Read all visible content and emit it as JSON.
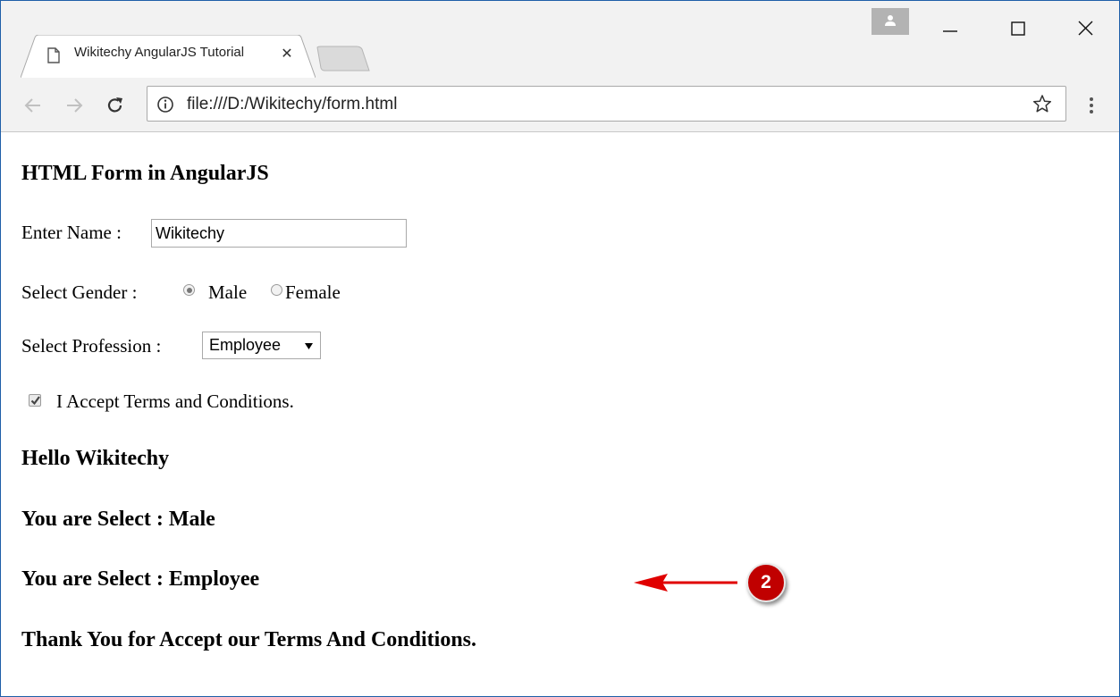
{
  "browser": {
    "tab_title": "Wikitechy AngularJS Tutorial",
    "tab_close": "✕",
    "url": "file:///D:/Wikitechy/form.html"
  },
  "page": {
    "heading": "HTML Form in AngularJS",
    "name_label": "Enter Name :",
    "name_value": "Wikitechy",
    "gender_label": "Select Gender :",
    "gender_options": [
      "Male",
      "Female"
    ],
    "gender_selected": "Male",
    "profession_label": "Select Profession :",
    "profession_selected": "Employee",
    "terms_label": "I Accept Terms and Conditions.",
    "terms_checked": true,
    "output_hello": "Hello Wikitechy",
    "output_gender": "You are Select : Male",
    "output_profession": "You are Select : Employee",
    "output_terms": "Thank You for Accept our Terms And Conditions."
  },
  "annotation": {
    "badge_number": "2",
    "color": "#e00000"
  }
}
